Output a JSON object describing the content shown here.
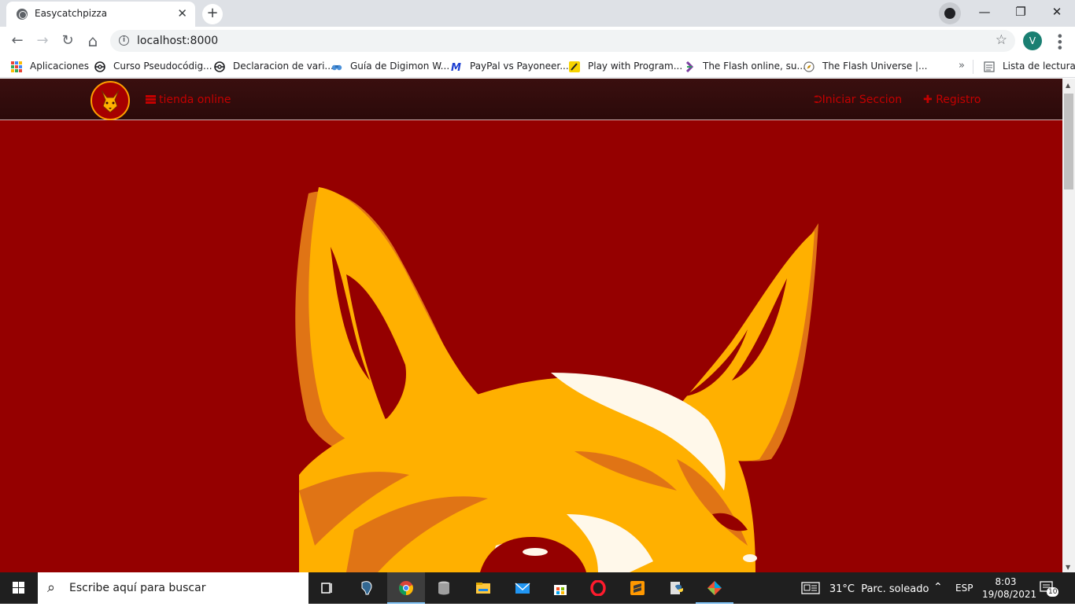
{
  "browser": {
    "tab_title": "Easycatchpizza",
    "tab_close": "✕",
    "new_tab": "+",
    "url": "localhost:8000",
    "profile_initial": "V",
    "window_controls": {
      "minimize": "—",
      "restore": "❐",
      "close": "✕"
    },
    "nav": {
      "back": "←",
      "forward": "→",
      "reload": "↻",
      "home": "⌂"
    },
    "bookmark_star": "☆",
    "bookmarks": [
      {
        "label": "Aplicaciones",
        "icon": "apps-grid-icon"
      },
      {
        "label": "Curso Pseudocódig...",
        "icon": "pokeball-icon"
      },
      {
        "label": "Declaracion de vari...",
        "icon": "pokeball-icon"
      },
      {
        "label": "Guía de Digimon W...",
        "icon": "binoculars-icon"
      },
      {
        "label": "PayPal vs Payoneer...",
        "icon": "m-logo-icon"
      },
      {
        "label": "Play with Program...",
        "icon": "play-logo-icon"
      },
      {
        "label": "The Flash online, su...",
        "icon": "chevron-logo-icon"
      },
      {
        "label": "The Flash Universe |...",
        "icon": "compass-icon"
      }
    ],
    "bookmarks_overflow": "»",
    "reading_list": "Lista de lectura"
  },
  "site": {
    "brand": "tienda online",
    "login": "Iniciar Seccion",
    "register": "Registro",
    "colors": {
      "background": "#950000",
      "navbar": "#2b0a0a",
      "link": "#c40000",
      "fox_orange": "#ffb000",
      "fox_dark_orange": "#e87d10",
      "fox_white": "#fff8ea"
    }
  },
  "taskbar": {
    "search_placeholder": "Escribe aquí para buscar",
    "weather": "31°C  Parc. soleado",
    "language": "ESP",
    "time": "8:03",
    "date": "19/08/2021",
    "notifications": "10",
    "apps": [
      "task-view-icon",
      "postgres-icon",
      "chrome-icon",
      "database-icon",
      "file-explorer-icon",
      "mail-icon",
      "store-icon",
      "opera-icon",
      "sublime-icon",
      "python-icon",
      "git-icon"
    ]
  }
}
